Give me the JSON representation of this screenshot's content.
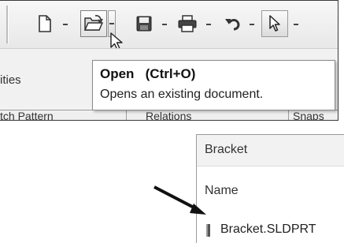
{
  "toolbar": {
    "buttons": [
      {
        "name": "new-document"
      },
      {
        "name": "open-document"
      },
      {
        "name": "save-document"
      },
      {
        "name": "print-document"
      },
      {
        "name": "undo"
      },
      {
        "name": "select"
      }
    ]
  },
  "panel": {
    "partial_label": "ities",
    "tabs": [
      "tch Pattern",
      "Relations",
      "Snaps"
    ]
  },
  "tooltip": {
    "title": "Open",
    "shortcut": "(Ctrl+O)",
    "description": "Opens an existing document."
  },
  "dialog": {
    "folder": "Bracket",
    "column_header": "Name",
    "file_name": "Bracket.SLDPRT"
  }
}
